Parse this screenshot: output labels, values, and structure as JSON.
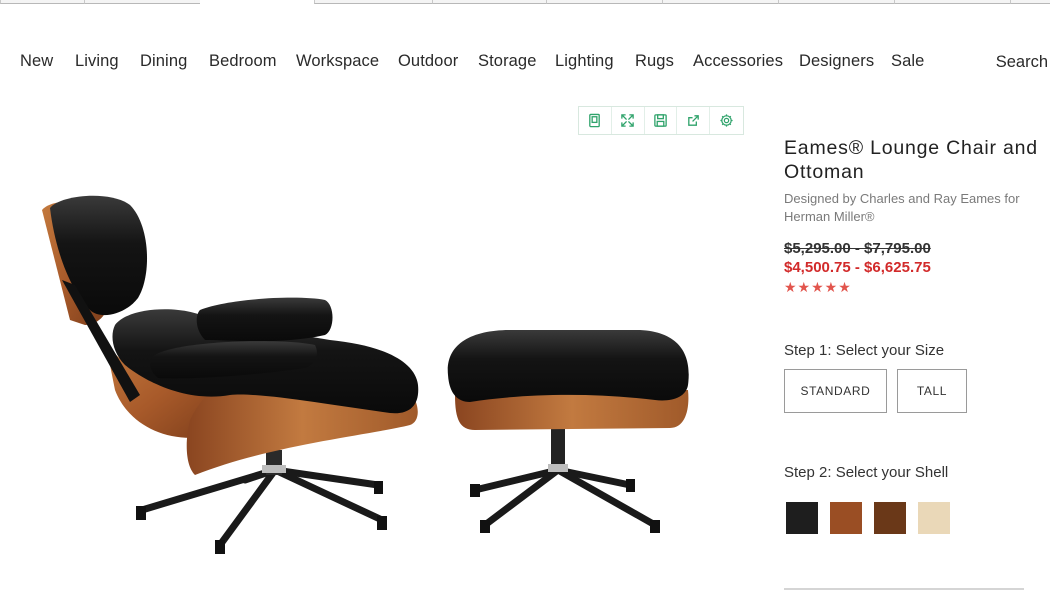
{
  "nav": {
    "items": [
      "New",
      "Living",
      "Dining",
      "Bedroom",
      "Workspace",
      "Outdoor",
      "Storage",
      "Lighting",
      "Rugs",
      "Accessories",
      "Designers",
      "Sale"
    ],
    "search_label": "Search"
  },
  "toolbar": {
    "icons": [
      "bookmark-icon",
      "expand-icon",
      "save-icon",
      "share-icon",
      "settings-icon"
    ]
  },
  "product": {
    "title": "Eames® Lounge Chair and Ottoman",
    "designer": "Designed by Charles and Ray Eames for Herman Miller®",
    "price_original": "$5,295.00 - $7,795.00",
    "price_sale": "$4,500.75 - $6,625.75",
    "rating_stars": "★★★★★",
    "rating": 5
  },
  "step1": {
    "label": "Step 1: Select your Size",
    "options": [
      "STANDARD",
      "TALL"
    ]
  },
  "step2": {
    "label": "Step 2: Select your Shell",
    "swatches": [
      {
        "name": "black",
        "color": "#1e1e1e"
      },
      {
        "name": "walnut",
        "color": "#9a4e24"
      },
      {
        "name": "dark-walnut",
        "color": "#6a3818"
      },
      {
        "name": "white-ash",
        "color": "#ead8b8"
      }
    ]
  },
  "colors": {
    "sale_price": "#d22a2a",
    "stars": "#e2554d",
    "toolbar_icons": "#2fa36b"
  }
}
